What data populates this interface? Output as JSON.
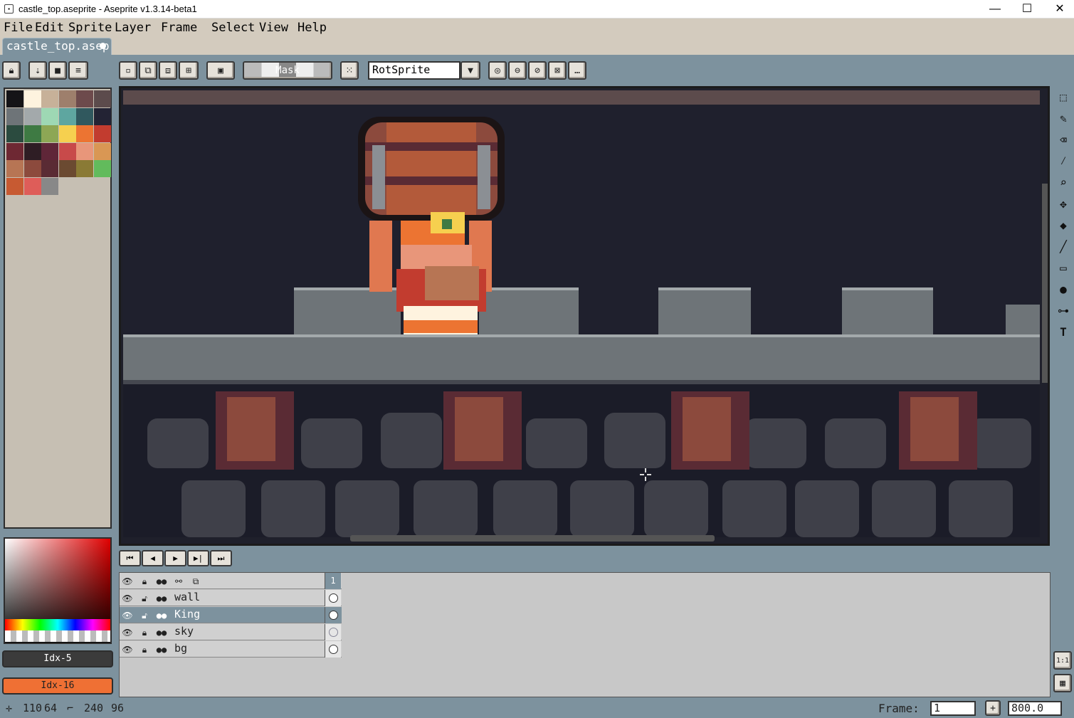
{
  "window": {
    "title": "castle_top.aseprite - Aseprite v1.3.14-beta1",
    "minimize": "—",
    "maximize": "☐",
    "close": "✕"
  },
  "menu": [
    "File",
    "Edit",
    "Sprite",
    "Layer",
    "Frame",
    "Select",
    "View",
    "Help"
  ],
  "tab": {
    "label": "castle_top.asep"
  },
  "toolbar": {
    "mask_label": "Mask",
    "rotation_algorithm": "RotSprite"
  },
  "palette": {
    "colors": [
      "#151417",
      "#fef3df",
      "#c7b199",
      "#9e7f6c",
      "#6d4a4c",
      "#5c4b4c",
      "#6e7478",
      "#a3a9ab",
      "#9ed8b4",
      "#5ea6a0",
      "#30585e",
      "#232334",
      "#2b4b3f",
      "#3e7a43",
      "#8da755",
      "#f6d04f",
      "#ec7432",
      "#c23c2f",
      "#6e2833",
      "#2e1d24",
      "#5f2638",
      "#c84a4a",
      "#e8967a",
      "#d99754",
      "#b77554",
      "#8c4a3d",
      "#5a2b34",
      "#6b4a31",
      "#8a7a35",
      "#62bb5c",
      "#c75a32",
      "#de5d59",
      "#888888"
    ]
  },
  "colors": {
    "foreground_label": "Idx-5",
    "background_label": "Idx-16",
    "foreground": "#3b3b3b",
    "background": "#ef7034"
  },
  "layers": [
    {
      "name": "wall",
      "selected": false
    },
    {
      "name": "King",
      "selected": true
    },
    {
      "name": "sky",
      "selected": false
    },
    {
      "name": "bg",
      "selected": false
    }
  ],
  "frame_header": "1",
  "status": {
    "cursor_x": "110",
    "cursor_y": "64",
    "size_w": "240",
    "size_h": "96",
    "frame_label": "Frame:",
    "frame_value": "1",
    "zoom": "800.0"
  }
}
